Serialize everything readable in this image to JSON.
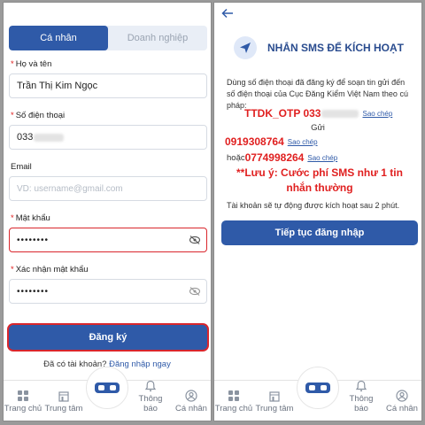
{
  "left": {
    "tabs": [
      {
        "label": "Cá nhân",
        "active": true
      },
      {
        "label": "Doanh nghiệp",
        "active": false
      }
    ],
    "fields": {
      "name": {
        "label": "Họ và tên",
        "required": true,
        "value": "Trần Thị Kim Ngọc"
      },
      "phone": {
        "label": "Số điện thoại",
        "required": true,
        "value_prefix": "033"
      },
      "email": {
        "label": "Email",
        "required": false,
        "placeholder": "VD: username@gmail.com"
      },
      "password": {
        "label": "Mật khẩu",
        "required": true,
        "value": "••••••••"
      },
      "confirm": {
        "label": "Xác nhận mật khẩu",
        "required": true,
        "value": "••••••••"
      }
    },
    "register_label": "Đăng ký",
    "login_prompt": "Đã có tài khoản?",
    "login_link": "Đăng nhập ngay"
  },
  "right": {
    "title": "NHẮN SMS ĐỂ KÍCH HOẠT",
    "description": "Dùng số điện thoại đã đăng ký để soạn tin gửi đến số điện thoại của Cục Đăng Kiểm Việt Nam theo cú pháp:",
    "syntax_prefix": "TTDK_OTP 033",
    "send_label": "Gửi",
    "number1": "0919308764",
    "or_label": "hoặc",
    "number2": "0774998264",
    "copy_label": "Sao chép",
    "note": "**Lưu ý: Cước phí SMS như 1 tin nhắn thường",
    "activation_note": "Tài khoản sẽ tự động được kích hoạt sau 2 phút.",
    "continue_label": "Tiếp tục đăng nhập"
  },
  "nav": {
    "home": "Trang chủ",
    "center": "Trung tâm",
    "notify": "Thông báo",
    "profile": "Cá nhân"
  },
  "colors": {
    "primary": "#2f5aa8",
    "danger": "#e02020",
    "title": "#2a4c8f"
  },
  "icons": [
    "back-arrow-icon",
    "send-icon",
    "eye-off-icon",
    "home-grid-icon",
    "building-icon",
    "vr-goggles-icon",
    "bell-icon",
    "user-icon"
  ]
}
